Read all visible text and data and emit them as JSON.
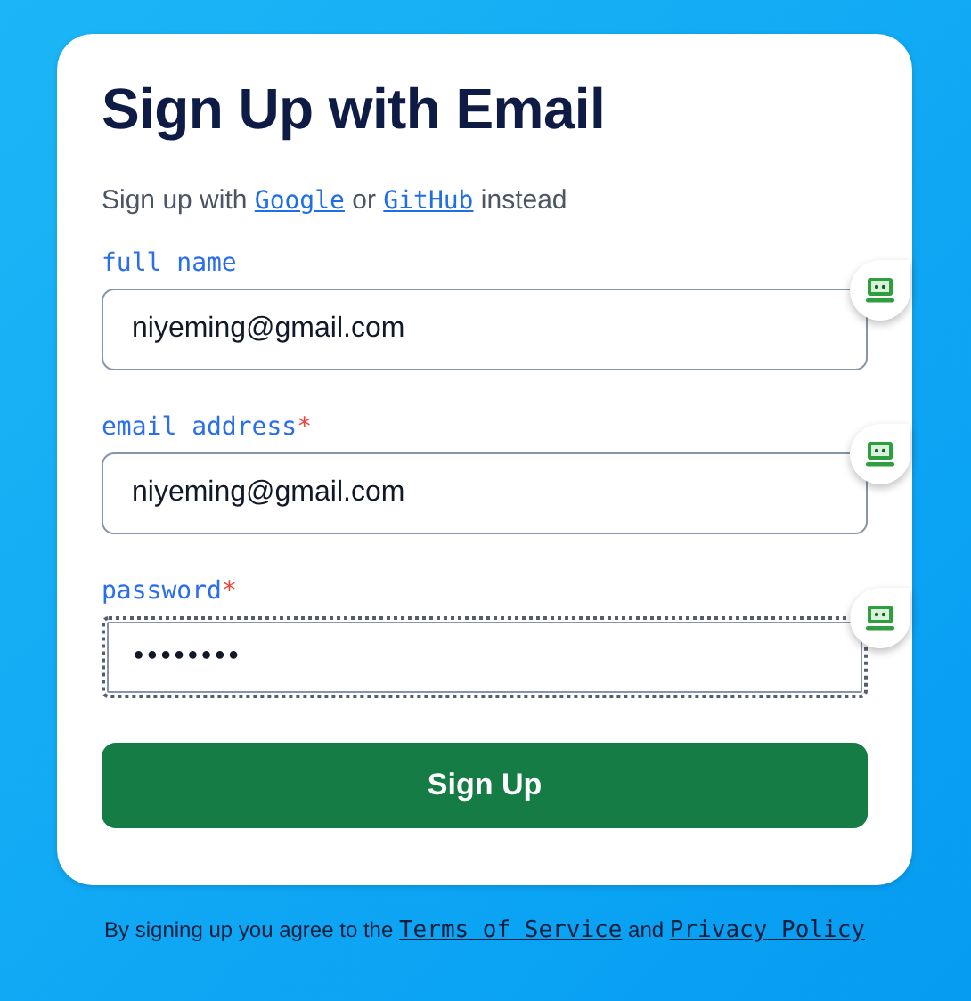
{
  "title": "Sign Up with Email",
  "intro": [
    {
      "kind": "text",
      "text": "Sign up with "
    },
    {
      "kind": "link",
      "text": "Google"
    },
    {
      "kind": "text",
      "text": " or "
    },
    {
      "kind": "link",
      "text": "GitHub"
    },
    {
      "kind": "text",
      "text": " instead"
    }
  ],
  "fields": [
    {
      "label": "full name",
      "required": false,
      "value": "niyeming@gmail.com",
      "focused": false
    },
    {
      "label": "email address",
      "required": true,
      "value": "niyeming@gmail.com",
      "focused": false
    },
    {
      "label": "password",
      "required": true,
      "value": "••••••••",
      "focused": true
    }
  ],
  "required_mark": "*",
  "submit": "Sign Up",
  "footer": [
    {
      "kind": "text",
      "text": "By signing up you agree to the "
    },
    {
      "kind": "link",
      "text": "Terms of Service"
    },
    {
      "kind": "text",
      "text": " and "
    },
    {
      "kind": "link",
      "text": "Privacy Policy"
    }
  ]
}
